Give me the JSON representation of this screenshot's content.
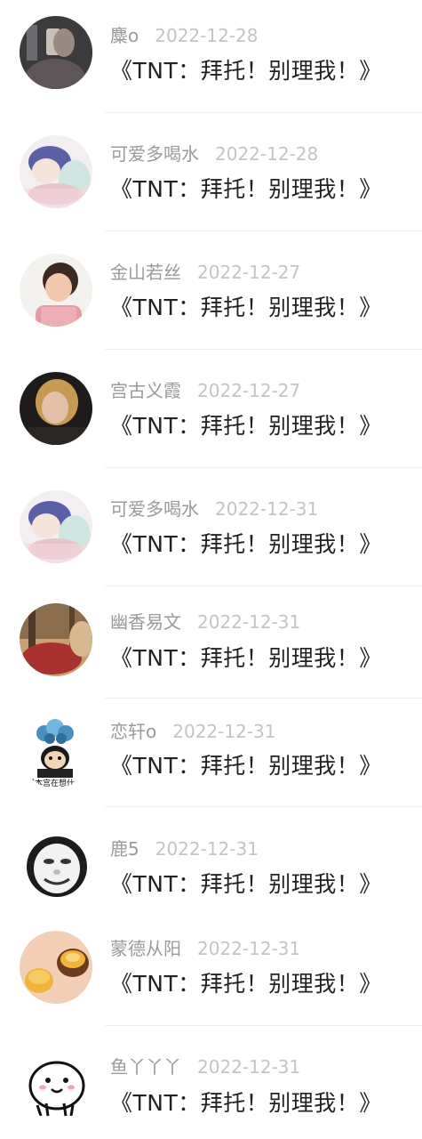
{
  "comments": [
    {
      "name": "麋o",
      "time": "2022-12-28",
      "text": "《TNT：拜托！别理我！》"
    },
    {
      "name": "可爱多喝水",
      "time": "2022-12-28",
      "text": "《TNT：拜托！别理我！》"
    },
    {
      "name": "金山若丝",
      "time": "2022-12-27",
      "text": "《TNT：拜托！别理我！》"
    },
    {
      "name": "宫古义霞",
      "time": "2022-12-27",
      "text": "《TNT：拜托！别理我！》"
    },
    {
      "name": "可爱多喝水",
      "time": "2022-12-31",
      "text": "《TNT：拜托！别理我！》"
    },
    {
      "name": "幽香易文",
      "time": "2022-12-31",
      "text": "《TNT：拜托！别理我！》"
    },
    {
      "name": "恋轩o",
      "time": "2022-12-31",
      "text": "《TNT：拜托！别理我！》",
      "avatar_caption": "想本宫在想什"
    },
    {
      "name": "鹿5",
      "time": "2022-12-31",
      "text": "《TNT：拜托！别理我！》"
    },
    {
      "name": "蒙德从阳",
      "time": "2022-12-31",
      "text": "《TNT：拜托！别理我！》"
    },
    {
      "name": "鱼丫丫丫",
      "time": "2022-12-31",
      "text": "《TNT：拜托！别理我！》"
    }
  ],
  "colors": {
    "name": "#9a9a9a",
    "time": "#c4c4c4",
    "text": "#222222",
    "divider": "#eeeeee"
  }
}
